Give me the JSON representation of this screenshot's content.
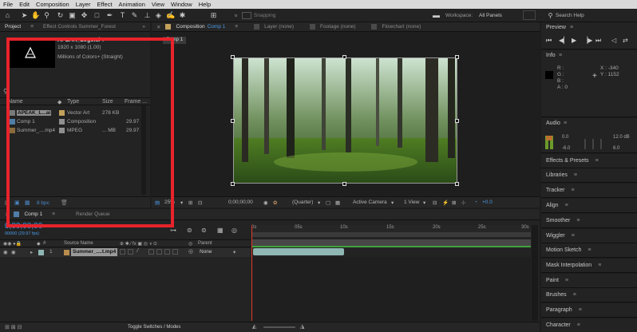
{
  "menubar": [
    "File",
    "Edit",
    "Composition",
    "Layer",
    "Effect",
    "Animation",
    "View",
    "Window",
    "Help"
  ],
  "toolbar": {
    "snapping_label": "Snapping",
    "workspace_label": "Workspace:",
    "workspace_value": "All Panels",
    "search_placeholder": "Search Help"
  },
  "project_panel": {
    "tab_project": "Project",
    "tab_effect_controls": "Effect Controls Summer_Forest",
    "asset_name": "APEAK_Logo.ai ▾",
    "asset_dims": "1920 x 1080 (1.00)",
    "asset_color": "Millions of Colors+ (Straight)",
    "columns": [
      "Name",
      "Type",
      "Size",
      "Frame ..."
    ],
    "items": [
      {
        "name": "APEAK_L...ai",
        "type": "Vector Art",
        "size": "278 KB",
        "frame": ""
      },
      {
        "name": "Comp 1",
        "type": "Composition",
        "size": "",
        "frame": "29.97"
      },
      {
        "name": "Summer_....mp4",
        "type": "MPEG",
        "size": "... MB",
        "frame": "29.97"
      }
    ],
    "bpc": "8 bpc"
  },
  "comp_panel": {
    "tabs": [
      "Composition",
      "Comp 1",
      "Layer (none)",
      "Footage (none)",
      "Flowchart (none)"
    ],
    "sub_tab": "Comp 1",
    "zoom": "25%",
    "timecode": "0;00;00;00",
    "quality": "(Quarter)",
    "camera": "Active Camera",
    "views": "1 View",
    "exposure": "+0.0"
  },
  "right_panel": {
    "preview_label": "Preview",
    "info_label": "Info",
    "info_rgba": [
      "R :",
      "G :",
      "B :",
      "A : 0"
    ],
    "info_xy": [
      "X : -340",
      "Y : 1152"
    ],
    "audio_label": "Audio",
    "audio_values": [
      "0.0",
      "-6.0",
      "12.0 dB",
      "6.0"
    ],
    "items": [
      "Effects & Presets",
      "Libraries",
      "Tracker",
      "Align",
      "Smoother",
      "Wiggler",
      "Motion Sketch",
      "Mask Interpolation",
      "Paint",
      "Brushes",
      "Paragraph",
      "Character"
    ]
  },
  "timeline": {
    "tab_comp": "Comp 1",
    "tab_render": "Render Queue",
    "timecode": "0;00;00;00",
    "fps": "00000 (29.97 fps)",
    "col_source": "Source Name",
    "col_parent": "Parent",
    "layer_num": "1",
    "layer_name": "Summer_....t.mp4",
    "layer_parent": "None",
    "ticks": [
      "0s",
      "05s",
      "10s",
      "15s",
      "20s",
      "25s",
      "30s"
    ],
    "toggle_label": "Toggle Switches / Modes"
  },
  "colors": {
    "highlight_red": "#e8232b",
    "accent_blue": "#2e8bd8",
    "audio_green": "#5aa12e",
    "clip_teal": "#8fb7b3"
  }
}
